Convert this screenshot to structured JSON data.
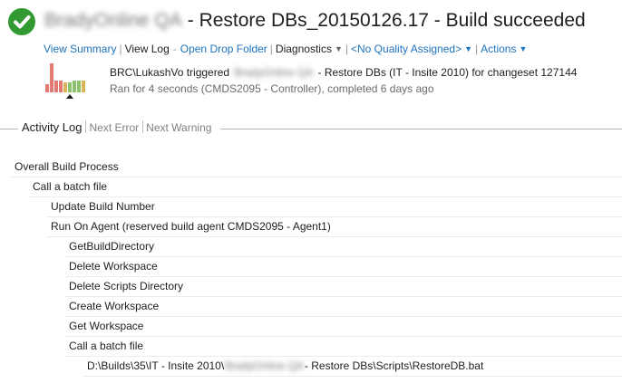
{
  "header": {
    "status_icon": "check-circle-icon",
    "status_color": "#339933",
    "title_prefix": "BradyOnline QA",
    "title_main": "- Restore DBs_20150126.17 - Build succeeded"
  },
  "links": {
    "view_summary": "View Summary",
    "view_log": "View Log",
    "open_drop_folder": "Open Drop Folder",
    "diagnostics": "Diagnostics",
    "quality": "<No Quality Assigned>",
    "actions": "Actions"
  },
  "build_info": {
    "user": "BRC\\LukashVo triggered",
    "definition_prefix": "BradyOnline QA",
    "definition_rest": "- Restore DBs (IT - Insite 2010) for changeset 127144",
    "run_text": "Ran for 4 seconds (CMDS2095 - Controller), completed 6 days ago"
  },
  "build_history": {
    "bars": [
      {
        "level": 0.28,
        "color": "#e07a72"
      },
      {
        "level": 1.0,
        "color": "#e07a72"
      },
      {
        "level": 0.4,
        "color": "#e07a72"
      },
      {
        "level": 0.4,
        "color": "#e07a72"
      },
      {
        "level": 0.35,
        "color": "#d9b35a"
      },
      {
        "level": 0.35,
        "color": "#8ac26e"
      },
      {
        "level": 0.42,
        "color": "#8ac26e"
      },
      {
        "level": 0.42,
        "color": "#8ac26e"
      },
      {
        "level": 0.42,
        "color": "#d9b35a"
      }
    ],
    "current_index": 5
  },
  "tabs": {
    "activity_log": "Activity Log",
    "next_error": "Next Error",
    "next_warning": "Next Warning"
  },
  "activity_log": [
    {
      "level": 0,
      "text": "Overall Build Process"
    },
    {
      "level": 1,
      "text": "Call a batch file"
    },
    {
      "level": 2,
      "text": "Update Build Number"
    },
    {
      "level": 2,
      "text": "Run On Agent (reserved build agent CMDS2095 - Agent1)"
    },
    {
      "level": 3,
      "text": "GetBuildDirectory"
    },
    {
      "level": 3,
      "text": "Delete Workspace"
    },
    {
      "level": 3,
      "text": "Delete Scripts Directory"
    },
    {
      "level": 3,
      "text": "Create Workspace"
    },
    {
      "level": 3,
      "text": "Get Workspace"
    },
    {
      "level": 3,
      "text": "Call a batch file"
    },
    {
      "level": 4,
      "text": "D:\\Builds\\35\\IT - Insite 2010\\",
      "blurred": "BradyOnline QA",
      "suffix": "- Restore DBs\\Scripts\\RestoreDB.bat"
    }
  ]
}
